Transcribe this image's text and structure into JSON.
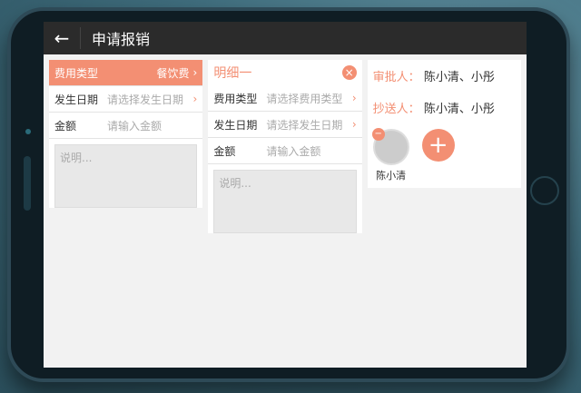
{
  "header": {
    "title": "申请报销",
    "back_icon": "arrow-left-icon"
  },
  "detail0": {
    "type_label": "费用类型",
    "type_value": "餐饮费",
    "date_label": "发生日期",
    "date_placeholder": "请选择发生日期",
    "amount_label": "金额",
    "amount_placeholder": "请输入金额",
    "note_placeholder": "说明..."
  },
  "detail1": {
    "title": "明细一",
    "type_label": "费用类型",
    "type_placeholder": "请选择费用类型",
    "date_label": "发生日期",
    "date_placeholder": "请选择发生日期",
    "amount_label": "金额",
    "amount_placeholder": "请输入金额",
    "note_placeholder": "说明..."
  },
  "approver": {
    "label": "审批人：",
    "value": "陈小清、小彤"
  },
  "cc": {
    "label": "抄送人：",
    "value": "陈小清、小彤"
  },
  "avatars": [
    {
      "name": "陈小清"
    }
  ],
  "colors": {
    "accent": "#f38f73",
    "topbar": "#2b2b2b"
  }
}
